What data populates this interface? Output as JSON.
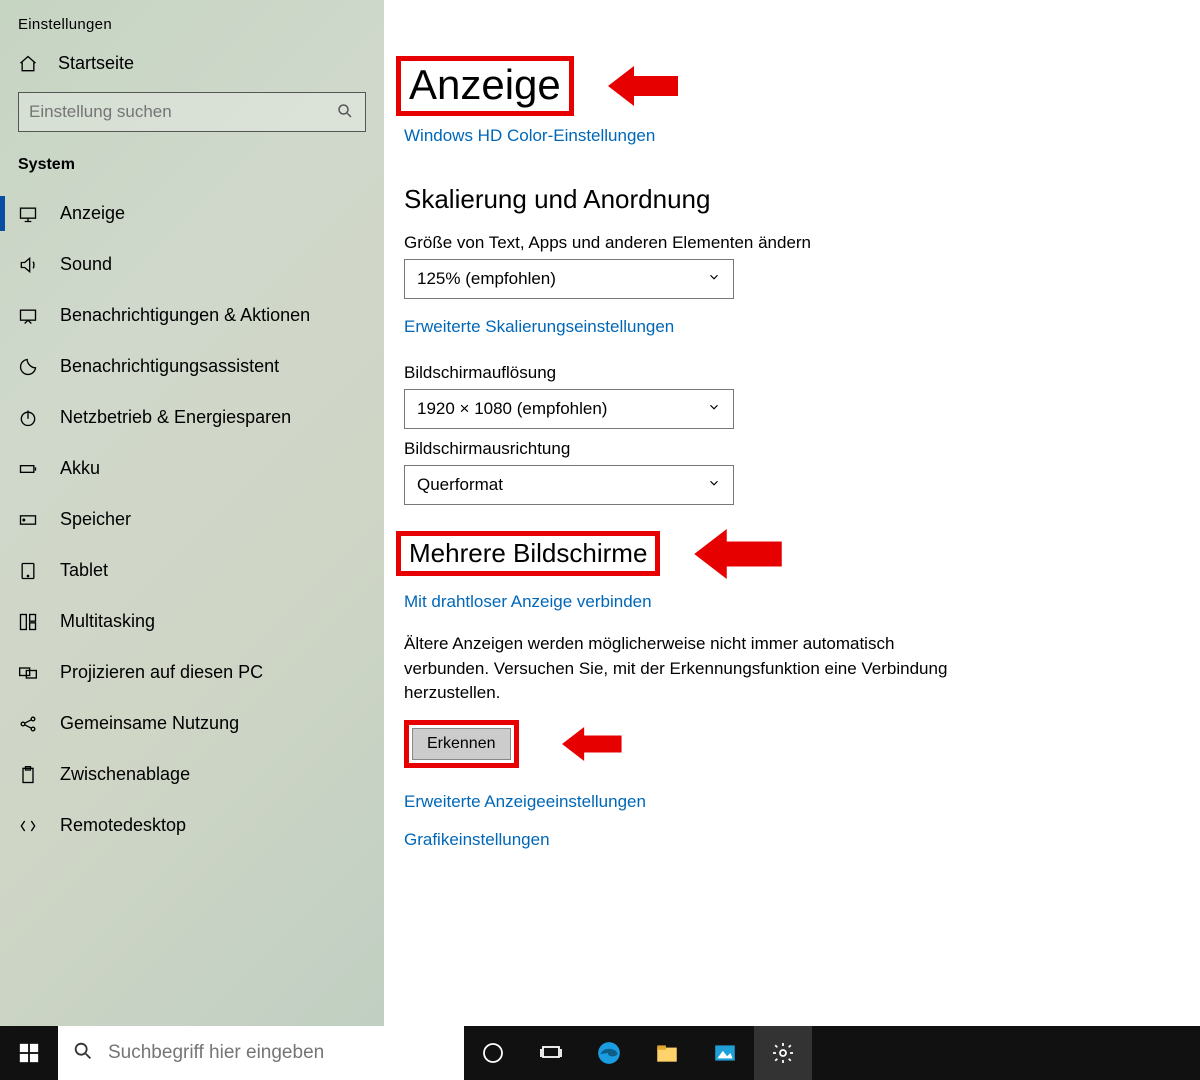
{
  "window": {
    "title": "Einstellungen"
  },
  "sidebar": {
    "home": "Startseite",
    "search_placeholder": "Einstellung suchen",
    "category": "System",
    "items": [
      {
        "label": "Anzeige"
      },
      {
        "label": "Sound"
      },
      {
        "label": "Benachrichtigungen & Aktionen"
      },
      {
        "label": "Benachrichtigungsassistent"
      },
      {
        "label": "Netzbetrieb & Energiesparen"
      },
      {
        "label": "Akku"
      },
      {
        "label": "Speicher"
      },
      {
        "label": "Tablet"
      },
      {
        "label": "Multitasking"
      },
      {
        "label": "Projizieren auf diesen PC"
      },
      {
        "label": "Gemeinsame Nutzung"
      },
      {
        "label": "Zwischenablage"
      },
      {
        "label": "Remotedesktop"
      }
    ]
  },
  "main": {
    "title": "Anzeige",
    "hd_link": "Windows HD Color-Einstellungen",
    "scaling": {
      "heading": "Skalierung und Anordnung",
      "size_label": "Größe von Text, Apps und anderen Elementen ändern",
      "size_value": "125% (empfohlen)",
      "advanced_scaling_link": "Erweiterte Skalierungseinstellungen",
      "resolution_label": "Bildschirmauflösung",
      "resolution_value": "1920 × 1080 (empfohlen)",
      "orientation_label": "Bildschirmausrichtung",
      "orientation_value": "Querformat"
    },
    "multi": {
      "heading": "Mehrere Bildschirme",
      "wireless_link": "Mit drahtloser Anzeige verbinden",
      "description": "Ältere Anzeigen werden möglicherweise nicht immer automatisch verbunden. Versuchen Sie, mit der Erkennungsfunktion eine Verbindung herzustellen.",
      "detect_button": "Erkennen",
      "advanced_display_link": "Erweiterte Anzeigeeinstellungen",
      "graphics_link": "Grafikeinstellungen"
    }
  },
  "taskbar": {
    "search_placeholder": "Suchbegriff hier eingeben"
  }
}
